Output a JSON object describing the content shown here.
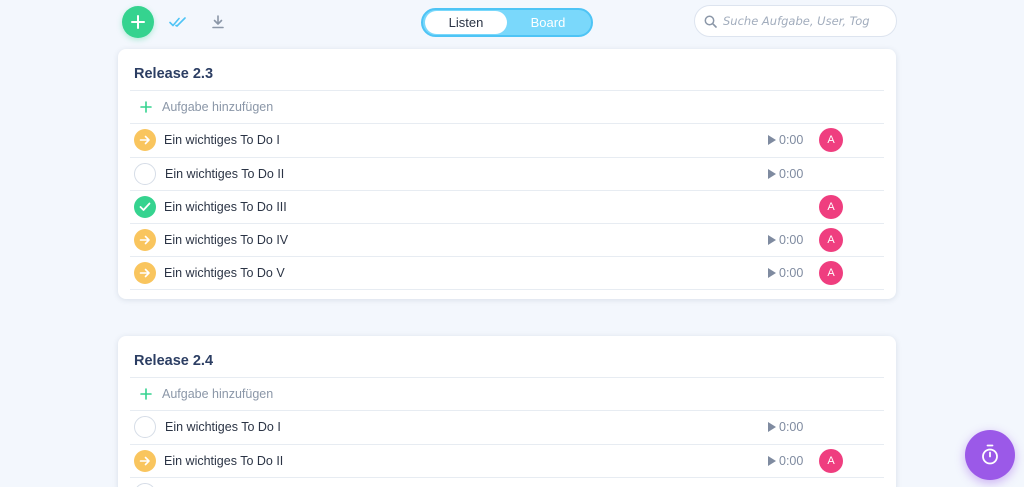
{
  "toolbar": {
    "add_icon": "plus-icon",
    "check_icon": "double-check-icon",
    "download_icon": "download-icon",
    "view_toggle": {
      "options": [
        "Listen",
        "Board"
      ],
      "active": "Listen"
    },
    "search": {
      "placeholder": "Suche Aufgabe, User, Tog",
      "value": ""
    }
  },
  "colors": {
    "accent_green": "#35d38f",
    "progress_yellow": "#f9c55e",
    "avatar_pink": "#ef3e7f",
    "toggle_blue": "#7ad8fb",
    "fab_purple": "#9b59e8"
  },
  "releases": [
    {
      "title": "Release 2.3",
      "add_label": "Aufgabe hinzufügen",
      "tasks": [
        {
          "name": "Ein wichtiges To Do I",
          "status": "in-progress",
          "time": "0:00",
          "assignee": "A"
        },
        {
          "name": "Ein wichtiges To Do II",
          "status": "open",
          "time": "0:00",
          "assignee": ""
        },
        {
          "name": "Ein wichtiges To Do III",
          "status": "done",
          "time": "",
          "assignee": "A"
        },
        {
          "name": "Ein wichtiges To Do IV",
          "status": "in-progress",
          "time": "0:00",
          "assignee": "A"
        },
        {
          "name": "Ein wichtiges To Do V",
          "status": "in-progress",
          "time": "0:00",
          "assignee": "A"
        }
      ]
    },
    {
      "title": "Release 2.4",
      "add_label": "Aufgabe hinzufügen",
      "tasks": [
        {
          "name": "Ein wichtiges To Do I",
          "status": "open",
          "time": "0:00",
          "assignee": ""
        },
        {
          "name": "Ein wichtiges To Do II",
          "status": "in-progress",
          "time": "0:00",
          "assignee": "A"
        }
      ]
    }
  ],
  "fab_icon": "stopwatch-icon"
}
